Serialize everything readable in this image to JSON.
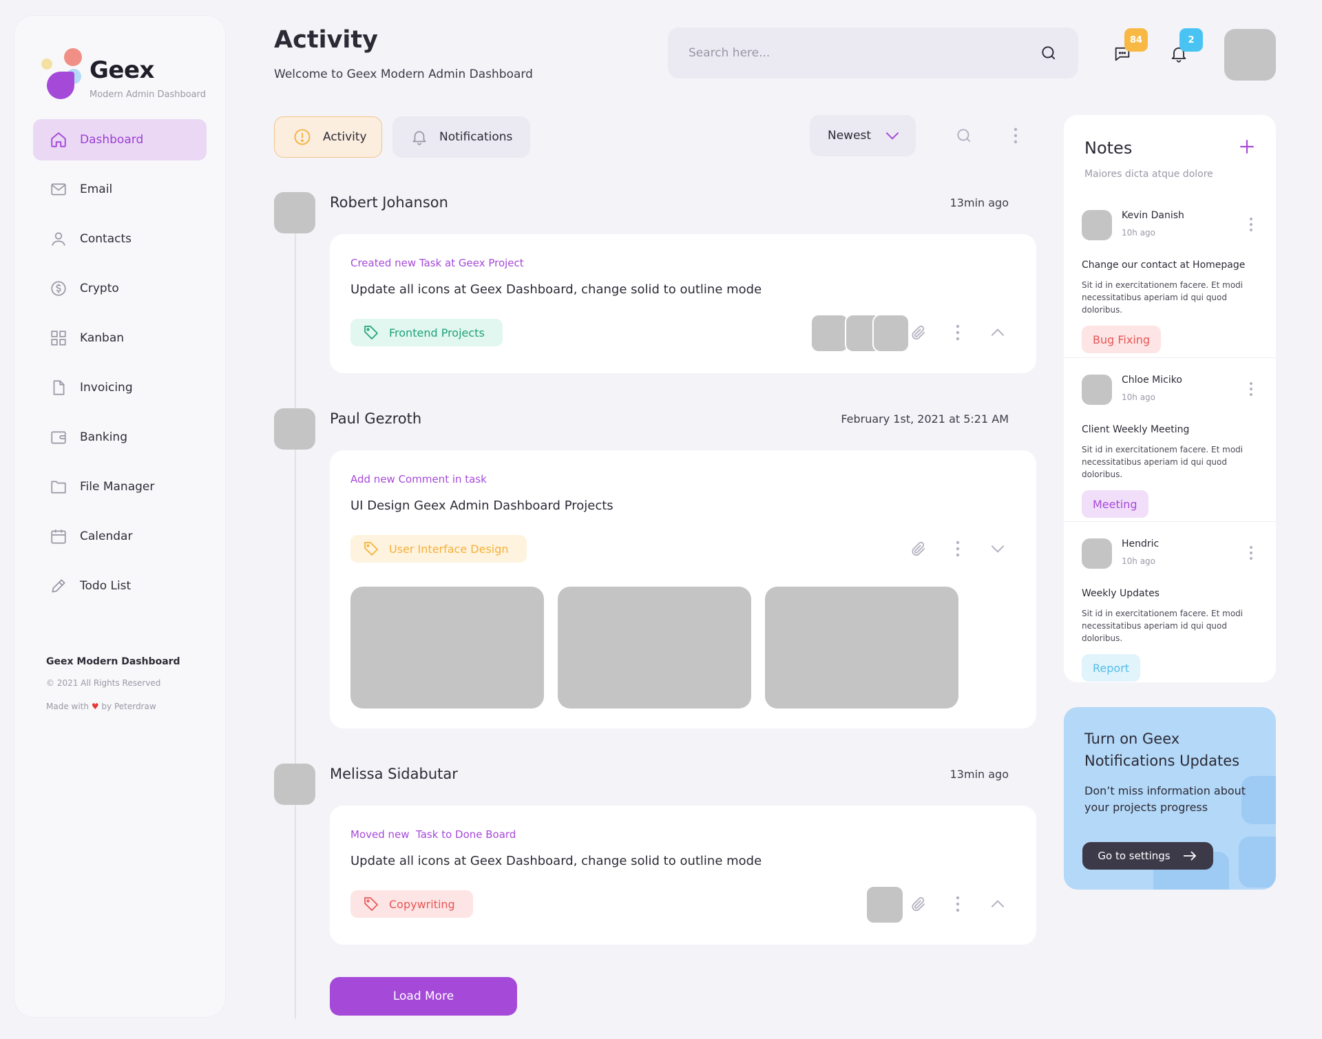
{
  "colors": {
    "accent": "#a549d9",
    "nav_active_bg": "#ead8f4",
    "badge_messages": "#f8b944",
    "badge_notifications": "#49c4f2",
    "tag_green": "#1ea278",
    "tag_yellow": "#f5b13a",
    "tag_red": "#e85555",
    "promo_bg": "#b4d8f8"
  },
  "brand": {
    "name": "Geex",
    "subtitle": "Modern Admin Dashboard"
  },
  "sidebar": {
    "items": [
      {
        "label": "Dashboard",
        "icon": "home-icon",
        "active": true
      },
      {
        "label": "Email",
        "icon": "mail-icon"
      },
      {
        "label": "Contacts",
        "icon": "user-icon"
      },
      {
        "label": "Crypto",
        "icon": "dollar-coin-icon"
      },
      {
        "label": "Kanban",
        "icon": "grid-icon"
      },
      {
        "label": "Invoicing",
        "icon": "file-icon"
      },
      {
        "label": "Banking",
        "icon": "wallet-icon"
      },
      {
        "label": "File Manager",
        "icon": "folder-icon"
      },
      {
        "label": "Calendar",
        "icon": "calendar-icon"
      },
      {
        "label": "Todo List",
        "icon": "pencil-icon"
      }
    ],
    "footer": {
      "title": "Geex Modern Dashboard",
      "copyright": "© 2021 All Rights Reserved",
      "made_prefix": "Made with",
      "made_suffix": "by Peterdraw"
    }
  },
  "header": {
    "title": "Activity",
    "subtitle": "Welcome to Geex Modern Admin Dashboard",
    "search_placeholder": "Search here...",
    "messages_badge": "84",
    "notifications_badge": "2"
  },
  "tabs": [
    {
      "label": "Activity",
      "icon": "alert-circle-icon",
      "active": true
    },
    {
      "label": "Notifications",
      "icon": "bell-icon"
    }
  ],
  "sort": {
    "label": "Newest"
  },
  "activities": [
    {
      "name": "Robert Johanson",
      "time": "13min ago",
      "type": "Created new Task at Geex Project",
      "title": "Update all icons at Geex Dashboard, change solid to outline mode",
      "tag": "Frontend Projects",
      "expanded": false
    },
    {
      "name": "Paul Gezroth",
      "time": "February 1st, 2021 at 5:21 AM",
      "type": "Add new Comment in task",
      "title": "UI Design Geex Admin Dashboard Projects",
      "tag": "User Interface Design",
      "expanded": true
    },
    {
      "name": "Melissa Sidabutar",
      "time": "13min ago",
      "type": "Moved new  Task to Done Board",
      "title": "Update all icons at Geex Dashboard, change solid to outline mode",
      "tag": "Copywriting",
      "expanded": false
    }
  ],
  "load_more": "Load More",
  "notes": {
    "title": "Notes",
    "subtitle": "Maiores dicta atque dolore",
    "items": [
      {
        "name": "Kevin Danish",
        "time": "10h ago",
        "title": "Change our contact at Homepage",
        "body": "Sit id in exercitationem facere. Et modi necessitatibus aperiam id qui quod doloribus.",
        "tag": "Bug Fixing"
      },
      {
        "name": "Chloe Miciko",
        "time": "10h ago",
        "title": "Client Weekly Meeting",
        "body": "Sit id in exercitationem facere. Et modi necessitatibus aperiam id qui quod doloribus.",
        "tag": "Meeting"
      },
      {
        "name": "Hendric",
        "time": "10h ago",
        "title": "Weekly Updates",
        "body": "Sit id in exercitationem facere. Et modi necessitatibus aperiam id qui quod doloribus.",
        "tag": "Report"
      }
    ]
  },
  "promo": {
    "title": "Turn on Geex Notifications Updates",
    "text": "Don’t miss information about your projects progress",
    "button": "Go to settings"
  }
}
